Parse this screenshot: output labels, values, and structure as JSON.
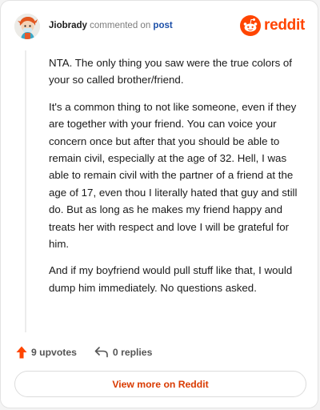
{
  "comment": {
    "username": "Jiobrady",
    "action_text": "commented on",
    "post_link": "post",
    "paragraphs": [
      "NTA. The only thing you saw were the true colors of your so called brother/friend.",
      "It's a common thing to not like someone, even if they are together with your friend. You can voice your concern once but after that you should be able to remain civil, especially at the age of 32. Hell, I was able to remain civil with the partner of a friend at the age of 17, even thou I literally hated that guy and still do. But as long as he makes my friend happy and treats her with respect and love I will be grateful for him.",
      "And if my boyfriend would pull stuff like that, I would dump him immediately. No questions asked."
    ]
  },
  "brand": {
    "logo_text": "reddit",
    "color": "#ff4500"
  },
  "actions": {
    "upvotes": "9 upvotes",
    "replies": "0 replies"
  },
  "footer": {
    "view_button": "View more on Reddit"
  },
  "icons": {
    "upvote": "upvote-arrow-icon",
    "reply": "reply-arrow-icon",
    "logo": "reddit-snoo-icon",
    "avatar": "user-avatar"
  }
}
